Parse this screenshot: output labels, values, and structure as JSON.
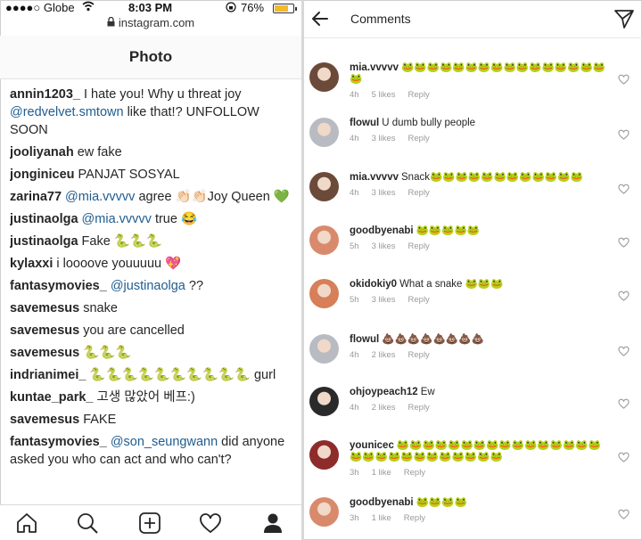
{
  "status_bar": {
    "carrier": "Globe",
    "time": "8:03 PM",
    "battery": "76%"
  },
  "browser": {
    "url": "instagram.com"
  },
  "photo_header": {
    "title": "Photo"
  },
  "comments_left": [
    {
      "user": "annin1203_",
      "segments": [
        {
          "t": "I hate you! Why u threat joy "
        },
        {
          "t": "@redvelvet.smtown",
          "m": true
        },
        {
          "t": " like that!? UNFOLLOW SOON"
        }
      ]
    },
    {
      "user": "jooliyanah",
      "segments": [
        {
          "t": "ew fake"
        }
      ]
    },
    {
      "user": "jonginiceu",
      "segments": [
        {
          "t": "PANJAT SOSYAL"
        }
      ]
    },
    {
      "user": "zarina77",
      "segments": [
        {
          "t": "@mia.vvvvv",
          "m": true
        },
        {
          "t": " agree 👏🏻👏🏻Joy Queen 💚"
        }
      ]
    },
    {
      "user": "justinaolga",
      "segments": [
        {
          "t": "@mia.vvvvv",
          "m": true
        },
        {
          "t": " true 😂"
        }
      ]
    },
    {
      "user": "justinaolga",
      "segments": [
        {
          "t": "Fake 🐍🐍🐍"
        }
      ]
    },
    {
      "user": "kylaxxi",
      "segments": [
        {
          "t": "i loooove youuuuu 💖"
        }
      ]
    },
    {
      "user": "fantasymovies_",
      "segments": [
        {
          "t": "@justinaolga",
          "m": true
        },
        {
          "t": " ??"
        }
      ]
    },
    {
      "user": "savemesus",
      "segments": [
        {
          "t": "snake"
        }
      ]
    },
    {
      "user": "savemesus",
      "segments": [
        {
          "t": "you are cancelled"
        }
      ]
    },
    {
      "user": "savemesus",
      "segments": [
        {
          "t": "🐍🐍🐍"
        }
      ]
    },
    {
      "user": "indrianimei_",
      "segments": [
        {
          "t": "🐍🐍🐍🐍🐍🐍🐍🐍🐍🐍 gurl"
        }
      ]
    },
    {
      "user": "kuntae_park_",
      "segments": [
        {
          "t": "고생 많았어 베프:)"
        }
      ]
    },
    {
      "user": "savemesus",
      "segments": [
        {
          "t": "FAKE"
        }
      ]
    },
    {
      "user": "fantasymovies_",
      "segments": [
        {
          "t": "@son_seungwann",
          "m": true
        },
        {
          "t": " did anyone asked you who can act and who can't?"
        }
      ]
    }
  ],
  "comments_header": {
    "title": "Comments"
  },
  "comments_right": [
    {
      "user": "mia.vvvvv",
      "text": "🐸🐸🐸🐸🐸🐸🐸🐸🐸🐸🐸🐸🐸🐸🐸🐸🐸",
      "time": "4h",
      "likes": "5 likes",
      "reply": "Reply",
      "avatar_color": "#6b4a3a"
    },
    {
      "user": "flowul",
      "text": "U dumb bully people",
      "time": "4h",
      "likes": "3 likes",
      "reply": "Reply",
      "avatar_color": "#b8bcc2"
    },
    {
      "user": "mia.vvvvv",
      "text": "Snack🐸🐸🐸🐸🐸🐸🐸🐸🐸🐸🐸🐸",
      "time": "4h",
      "likes": "3 likes",
      "reply": "Reply",
      "avatar_color": "#6b4a3a"
    },
    {
      "user": "goodbyenabi",
      "text": "🐸🐸🐸🐸🐸",
      "time": "5h",
      "likes": "3 likes",
      "reply": "Reply",
      "avatar_color": "#d98a6c"
    },
    {
      "user": "okidokiy0",
      "text": "What a snake 🐸🐸🐸",
      "time": "5h",
      "likes": "3 likes",
      "reply": "Reply",
      "avatar_color": "#d67f58"
    },
    {
      "user": "flowul",
      "text": "💩💩💩💩💩💩💩💩",
      "time": "4h",
      "likes": "2 likes",
      "reply": "Reply",
      "avatar_color": "#b8bcc2"
    },
    {
      "user": "ohjoypeach12",
      "text": "Ew",
      "time": "4h",
      "likes": "2 likes",
      "reply": "Reply",
      "avatar_color": "#2a2a2a"
    },
    {
      "user": "younicec",
      "text": "🐸🐸🐸🐸🐸🐸🐸🐸🐸🐸🐸🐸🐸🐸🐸🐸🐸🐸🐸🐸🐸🐸🐸🐸🐸🐸🐸🐸",
      "time": "3h",
      "likes": "1 like",
      "reply": "Reply",
      "avatar_color": "#8e2b2b"
    },
    {
      "user": "goodbyenabi",
      "text": "🐸🐸🐸🐸",
      "time": "3h",
      "likes": "1 like",
      "reply": "Reply",
      "avatar_color": "#d98a6c"
    }
  ]
}
